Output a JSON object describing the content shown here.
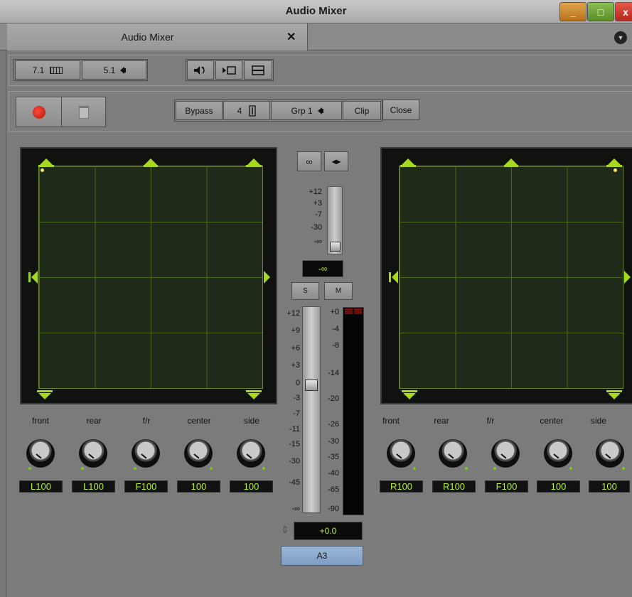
{
  "window": {
    "title": "Audio Mixer",
    "min": "_",
    "max": "□",
    "close": "x"
  },
  "tab": {
    "label": "Audio Mixer",
    "close": "✕",
    "menu": "▼"
  },
  "toolbar": {
    "format_a": "7.1",
    "format_b": "5.1"
  },
  "controls": {
    "bypass": "Bypass",
    "track_count": "4",
    "group": "Grp 1",
    "clip": "Clip",
    "close": "Close"
  },
  "knob_headers": [
    "front",
    "rear",
    "f/r",
    "center",
    "side"
  ],
  "left_values": [
    "L100",
    "L100",
    "F100",
    "100",
    "100"
  ],
  "right_values": [
    "R100",
    "R100",
    "F100",
    "100",
    "100"
  ],
  "center": {
    "link_icon": "∞",
    "swap_icon": "◂▸",
    "send_scale": [
      "+12",
      "+3",
      "-7",
      "-30",
      "-∞"
    ],
    "send_readout": "-∞",
    "solo": "S",
    "mute": "M",
    "fader_scale": [
      "+12",
      "+9",
      "+6",
      "+3",
      "0",
      "-3",
      "-7",
      "-11",
      "-15",
      "-30",
      "-45",
      "-∞"
    ],
    "meter_scale": [
      "+0",
      "-4",
      "-8",
      "-14",
      "-20",
      "-26",
      "-30",
      "-35",
      "-40",
      "-65",
      "-90"
    ],
    "gain_readout": "+0.0",
    "gain_stepper": "⇕",
    "track_name": "A3"
  }
}
